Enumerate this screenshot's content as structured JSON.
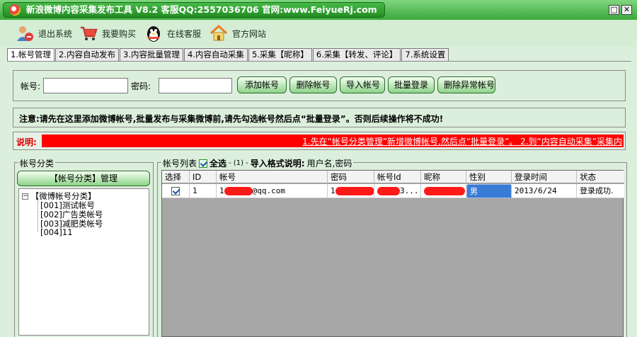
{
  "title": "新浪微博内容采集发布工具 V8.2 客服QQ:2557036706 官网:www.FeiyueRj.com",
  "window": {
    "minimize": "□",
    "close": "✕"
  },
  "toolbar": {
    "exit": "退出系统",
    "buy": "我要购买",
    "service": "在线客服",
    "website": "官方网站"
  },
  "tabs": [
    "1.帐号管理",
    "2.内容自动发布",
    "3.内容批量管理",
    "4.内容自动采集",
    "5.采集【昵称】",
    "6.采集【转发、评论】",
    "7.系统设置"
  ],
  "account_form": {
    "account_label": "帐号:",
    "password_label": "密码:",
    "account_value": "",
    "password_value": "",
    "add": "添加帐号",
    "delete": "删除帐号",
    "import": "导入帐号",
    "batch_login": "批量登录",
    "delete_abnormal": "删除异常帐号"
  },
  "notice": "注意:请先在这里添加微博帐号,批量发布与采集微博前,请先勾选帐号然后点“批量登录”。否则后续操作将不成功!",
  "explain": {
    "label": "说明:",
    "text": "1.先在“帐号分类管理”新增微博帐号,然后点“批量登录”。 2.到“内容自动采集”采集内"
  },
  "category": {
    "title": "帐号分类",
    "manage_button": "【帐号分类】管理",
    "root": "【微博帐号分类】",
    "items": [
      "[001]测试帐号",
      "[002]广告类帐号",
      "[003]减肥类帐号",
      "[004]11"
    ]
  },
  "list": {
    "title": "帐号列表",
    "select_all": "全选",
    "count": "- (1) -",
    "format_label": "导入格式说明:",
    "format_value": "用户名,密码",
    "columns": [
      "选择",
      "ID",
      "帐号",
      "密码",
      "帐号Id",
      "昵称",
      "性别",
      "登录时间",
      "状态"
    ],
    "rows": [
      {
        "selected": true,
        "id": "1",
        "account_prefix": "1",
        "account_suffix": "@qq.com",
        "password": "1",
        "account_id_suffix": "3...",
        "gender": "男",
        "login_time": "2013/6/24",
        "status": "登录成功."
      }
    ]
  },
  "colors": {
    "accent_green": "#3aa83a",
    "redact": "#ff1a1a",
    "explain_bar": "#ff0000"
  }
}
